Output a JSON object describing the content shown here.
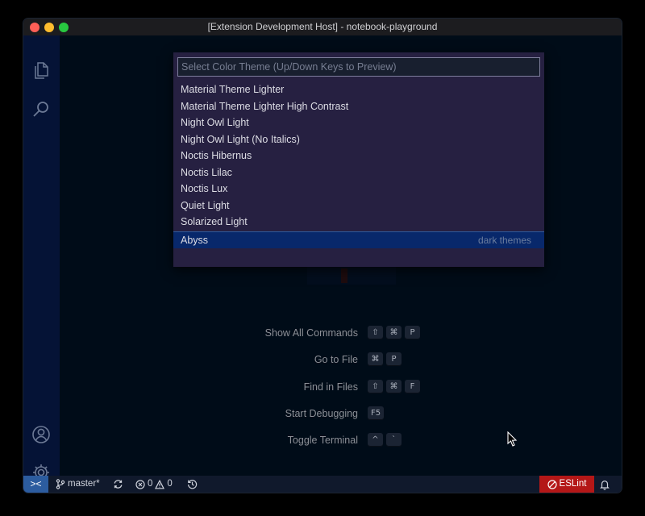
{
  "window": {
    "title": "[Extension Development Host] - notebook-playground"
  },
  "activity_bar": {
    "icons": [
      "files-icon",
      "search-icon",
      "account-icon",
      "settings-gear-icon"
    ]
  },
  "quick_pick": {
    "placeholder": "Select Color Theme (Up/Down Keys to Preview)",
    "items": [
      {
        "label": "Material Theme Lighter"
      },
      {
        "label": "Material Theme Lighter High Contrast"
      },
      {
        "label": "Night Owl Light"
      },
      {
        "label": "Night Owl Light (No Italics)"
      },
      {
        "label": "Noctis Hibernus"
      },
      {
        "label": "Noctis Lilac"
      },
      {
        "label": "Noctis Lux"
      },
      {
        "label": "Quiet Light"
      },
      {
        "label": "Solarized Light"
      }
    ],
    "selected": {
      "label": "Abyss",
      "detail": "dark themes"
    }
  },
  "shortcuts": [
    {
      "label": "Show All Commands",
      "keys": [
        "⇧",
        "⌘",
        "P"
      ]
    },
    {
      "label": "Go to File",
      "keys": [
        "⌘",
        "P"
      ]
    },
    {
      "label": "Find in Files",
      "keys": [
        "⇧",
        "⌘",
        "F"
      ]
    },
    {
      "label": "Start Debugging",
      "keys": [
        "F5"
      ]
    },
    {
      "label": "Toggle Terminal",
      "keys": [
        "^",
        "`"
      ]
    }
  ],
  "status_bar": {
    "remote_icon": "><",
    "branch": "master*",
    "errors": "0",
    "warnings": "0",
    "eslint": "ESLint"
  },
  "colors": {
    "editor_bg": "#000c18",
    "quickpick_bg": "#262041",
    "selection_bg": "#08286b",
    "activity_bg": "#051336",
    "eslint_bg": "#b41717",
    "remote_bg": "#2c5c9f"
  }
}
